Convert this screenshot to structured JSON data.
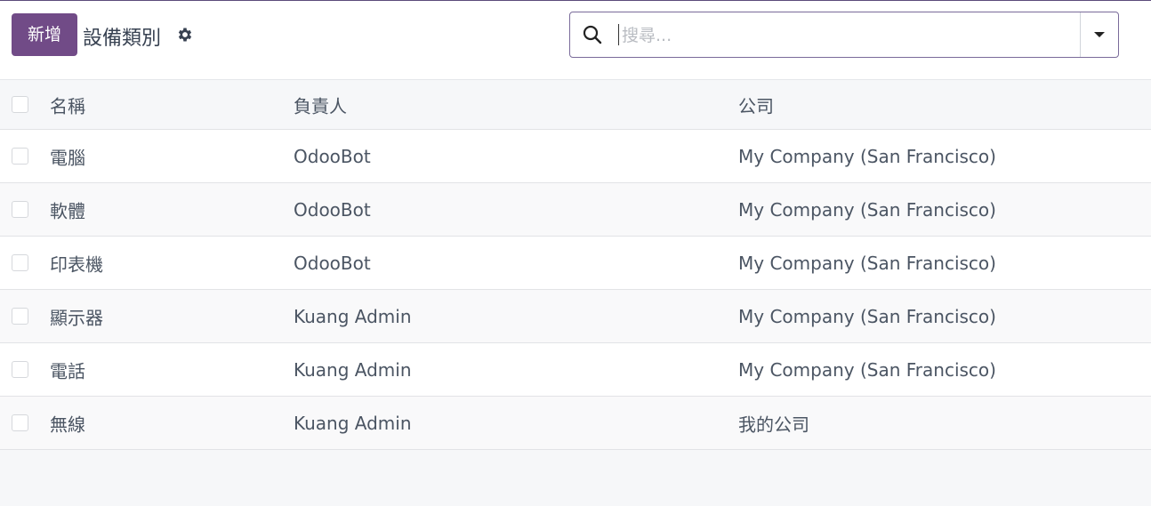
{
  "control_panel": {
    "new_button": "新增",
    "title": "設備類別",
    "search_placeholder": "搜尋..."
  },
  "list": {
    "headers": {
      "name": "名稱",
      "responsible": "負責人",
      "company": "公司"
    },
    "rows": [
      {
        "name": "電腦",
        "responsible": "OdooBot",
        "company": "My Company (San Francisco)"
      },
      {
        "name": "軟體",
        "responsible": "OdooBot",
        "company": "My Company (San Francisco)"
      },
      {
        "name": "印表機",
        "responsible": "OdooBot",
        "company": "My Company (San Francisco)"
      },
      {
        "name": "顯示器",
        "responsible": "Kuang Admin",
        "company": "My Company (San Francisco)"
      },
      {
        "name": "電話",
        "responsible": "Kuang Admin",
        "company": "My Company (San Francisco)"
      },
      {
        "name": "無線",
        "responsible": "Kuang Admin",
        "company": "我的公司"
      }
    ]
  },
  "icons": {
    "settings": "gear-icon",
    "search": "search-icon",
    "toggle": "caret-down-icon"
  },
  "colors": {
    "primary": "#714b87",
    "border": "#7a6b9a"
  }
}
